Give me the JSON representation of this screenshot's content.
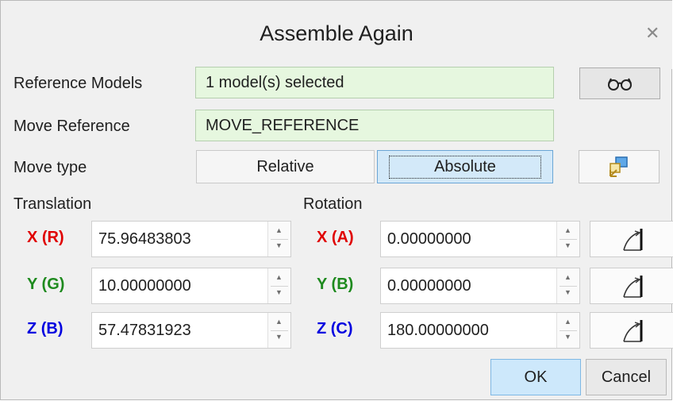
{
  "window": {
    "title": "Assemble Again",
    "close_icon": "close-icon"
  },
  "reference_models": {
    "label": "Reference Models",
    "value": "1 model(s) selected",
    "button_icon": "glasses-icon"
  },
  "move_reference": {
    "label": "Move Reference",
    "value": "MOVE_REFERENCE"
  },
  "move_type": {
    "label": "Move type",
    "options": [
      "Relative",
      "Absolute"
    ],
    "selected": "Absolute",
    "button_icon": "move-dragger-icon"
  },
  "translation": {
    "label": "Translation",
    "rows": [
      {
        "axis": "X (R)",
        "value": "75.96483803",
        "color": "#e00000"
      },
      {
        "axis": "Y (G)",
        "value": "10.00000000",
        "color": "#1e8a1e"
      },
      {
        "axis": "Z (B)",
        "value": "57.47831923",
        "color": "#0000e0"
      }
    ]
  },
  "rotation": {
    "label": "Rotation",
    "rows": [
      {
        "axis": "X (A)",
        "value": "0.00000000",
        "color": "#e00000"
      },
      {
        "axis": "Y (B)",
        "value": "0.00000000",
        "color": "#1e8a1e"
      },
      {
        "axis": "Z (C)",
        "value": "180.00000000",
        "color": "#0000e0"
      }
    ],
    "button_icon": "angle-measure-icon"
  },
  "buttons": {
    "ok": "OK",
    "cancel": "Cancel"
  },
  "colors": {
    "field_bg": "#e6f7df",
    "selected_bg": "#d3e9f9",
    "ok_bg": "#cde8fb"
  }
}
